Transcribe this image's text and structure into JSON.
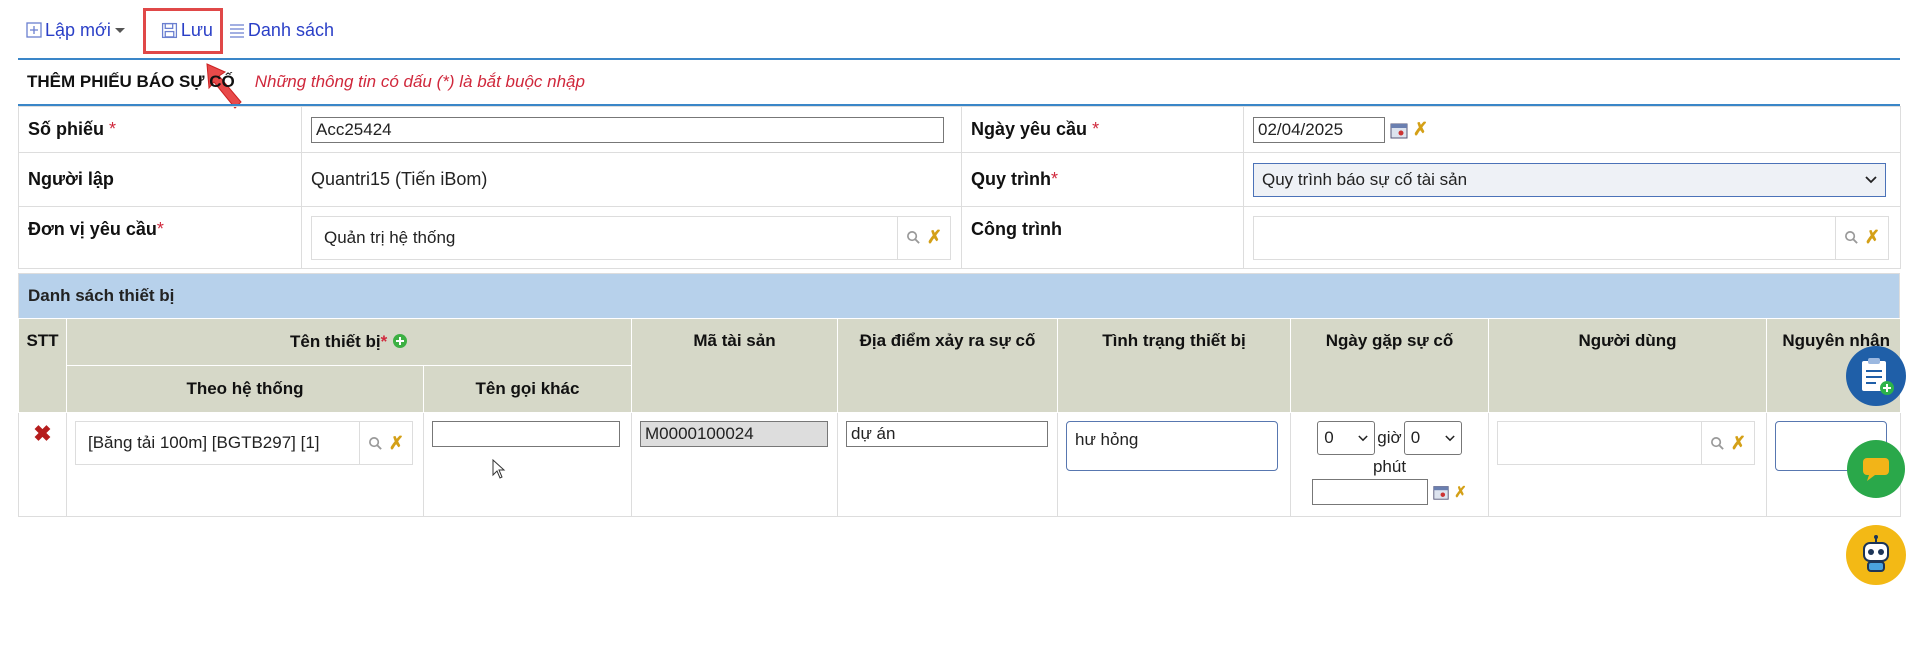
{
  "toolbar": {
    "new_label": "Lập mới",
    "save_label": "Lưu",
    "list_label": "Danh sách"
  },
  "header": {
    "title": "THÊM PHIẾU BÁO SỰ CỐ",
    "note": "Những thông tin có dấu (*) là bắt buộc nhập"
  },
  "form": {
    "so_phieu_label": "Số phiếu",
    "so_phieu_value": "Acc25424",
    "ngay_yc_label": "Ngày yêu cầu",
    "ngay_yc_value": "02/04/2025",
    "nguoi_lap_label": "Người lập",
    "nguoi_lap_value": "Quantri15 (Tiến iBom)",
    "quy_trinh_label": "Quy trình",
    "quy_trinh_value": "Quy trình báo sự cố tài sản",
    "don_vi_label": "Đơn vị yêu cầu",
    "don_vi_value": "Quản trị hệ thống",
    "cong_trinh_label": "Công trình",
    "cong_trinh_value": "",
    "req_mark": "*"
  },
  "grid": {
    "title": "Danh sách thiết bị",
    "headers": {
      "stt": "STT",
      "ten_tb": "Tên thiết bị",
      "theo_ht": "Theo hệ thống",
      "ten_khac": "Tên gọi khác",
      "ma_ts": "Mã tài sản",
      "dia_diem": "Địa điểm xảy ra sự cố",
      "tinh_trang": "Tình trạng thiết bị",
      "ngay_gap": "Ngày gặp sự cố",
      "nguoi_dung": "Người dùng",
      "nguyen_nhan": "Nguyên nhân"
    },
    "row": {
      "thiet_bi": "[Băng tải 100m] [BGTB297] [1]",
      "ten_khac": "",
      "ma_ts": "M0000100024",
      "dia_diem": "dự án",
      "tinh_trang": "hư hỏng",
      "gio": "0",
      "phut": "0",
      "gio_label": "giờ",
      "phut_label": "phút",
      "ngay": "",
      "nguoi_dung": "",
      "nguyen_nhan": ""
    }
  },
  "colors": {
    "accent": "#3a86c8",
    "link": "#2a3fc7",
    "required": "#d0283c",
    "highlight": "#e04848"
  }
}
